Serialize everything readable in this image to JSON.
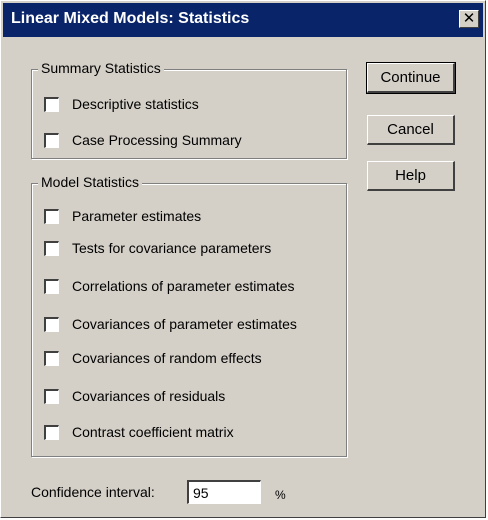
{
  "window": {
    "title": "Linear Mixed Models: Statistics",
    "close_glyph": "✕"
  },
  "summary": {
    "label": "Summary Statistics",
    "items": [
      {
        "label": "Descriptive statistics",
        "checked": false
      },
      {
        "label": "Case Processing Summary",
        "checked": false
      }
    ]
  },
  "model": {
    "label": "Model Statistics",
    "items": [
      {
        "label": "Parameter estimates",
        "checked": false
      },
      {
        "label": "Tests for covariance parameters",
        "checked": false
      },
      {
        "label": "Correlations of parameter estimates",
        "checked": false
      },
      {
        "label": "Covariances of parameter estimates",
        "checked": false
      },
      {
        "label": "Covariances of random effects",
        "checked": false
      },
      {
        "label": "Covariances of residuals",
        "checked": false
      },
      {
        "label": "Contrast coefficient matrix",
        "checked": false
      }
    ]
  },
  "buttons": {
    "continue": "Continue",
    "cancel": "Cancel",
    "help": "Help"
  },
  "confidence": {
    "label": "Confidence interval:",
    "value": "95",
    "unit": "%"
  }
}
